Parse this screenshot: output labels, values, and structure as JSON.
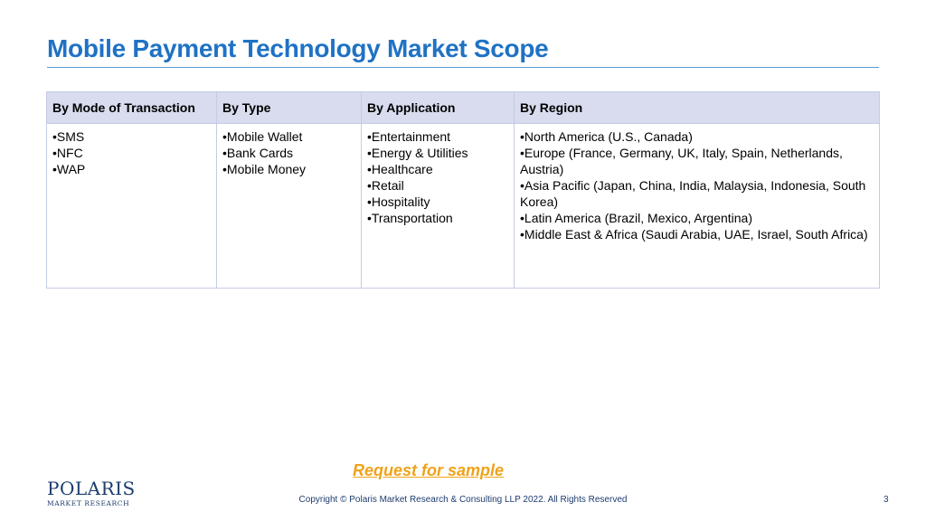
{
  "title": "Mobile Payment Technology Market Scope",
  "table": {
    "headers": [
      "By Mode of Transaction",
      "By Type",
      "By Application",
      "By Region"
    ],
    "columns": [
      [
        "•SMS",
        "•NFC",
        "•WAP"
      ],
      [
        "•Mobile Wallet",
        "•Bank Cards",
        "•Mobile Money"
      ],
      [
        "•Entertainment",
        "•Energy & Utilities",
        "•Healthcare",
        "•Retail",
        "•Hospitality",
        "•Transportation"
      ],
      [
        "•North America (U.S., Canada)",
        "•Europe (France, Germany, UK, Italy, Spain, Netherlands, Austria)",
        "•Asia Pacific (Japan, China, India, Malaysia, Indonesia, South Korea)",
        "•Latin America (Brazil, Mexico, Argentina)",
        "•Middle East & Africa (Saudi Arabia, UAE, Israel, South Africa)"
      ]
    ]
  },
  "request_link": "Request for sample",
  "logo": {
    "main": "POLARIS",
    "sub": "MARKET RESEARCH"
  },
  "footer": {
    "copyright": "Copyright © Polaris Market Research & Consulting LLP 2022. All Rights Reserved",
    "page_number": "3"
  },
  "colors": {
    "title": "#1f72c4",
    "header_bg": "#d8dcee",
    "link": "#f0a21a",
    "footer": "#1c3c6e"
  }
}
